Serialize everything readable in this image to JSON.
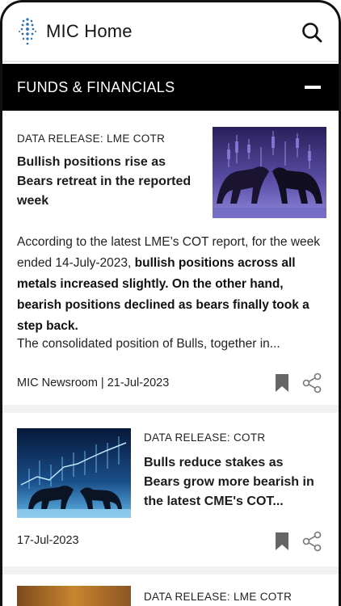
{
  "header": {
    "title": "MIC Home",
    "logo_icon": "mic-logo-icon",
    "search_icon": "search-icon"
  },
  "section": {
    "title": "FUNDS & FINANCIALS",
    "collapse_icon": "minus-icon"
  },
  "articles": [
    {
      "tag": "DATA RELEASE: LME COTR",
      "headline": "Bullish positions rise as Bears retreat in the reported week",
      "summary_plain": "According to the latest LME’s COT report, for the week ended 14-July-2023, ",
      "summary_bold": "bullish positions across all metals increased slightly. On the other hand, bearish positions declined as bears finally took a step back.",
      "summary_more": "The consolidated position of Bulls, together in...",
      "meta": "MIC Newsroom | 21-Jul-2023",
      "bookmark_icon": "bookmark-icon",
      "share_icon": "share-icon"
    },
    {
      "tag": "DATA RELEASE: COTR",
      "headline": "Bulls reduce stakes as Bears grow more bearish in the latest CME's COT...",
      "meta": "17-Jul-2023",
      "bookmark_icon": "bookmark-icon",
      "share_icon": "share-icon"
    },
    {
      "tag": "DATA RELEASE: LME COTR"
    }
  ],
  "colors": {
    "section_bg": "#000000",
    "text": "#1a1a1a",
    "bookmark": "#666666"
  }
}
